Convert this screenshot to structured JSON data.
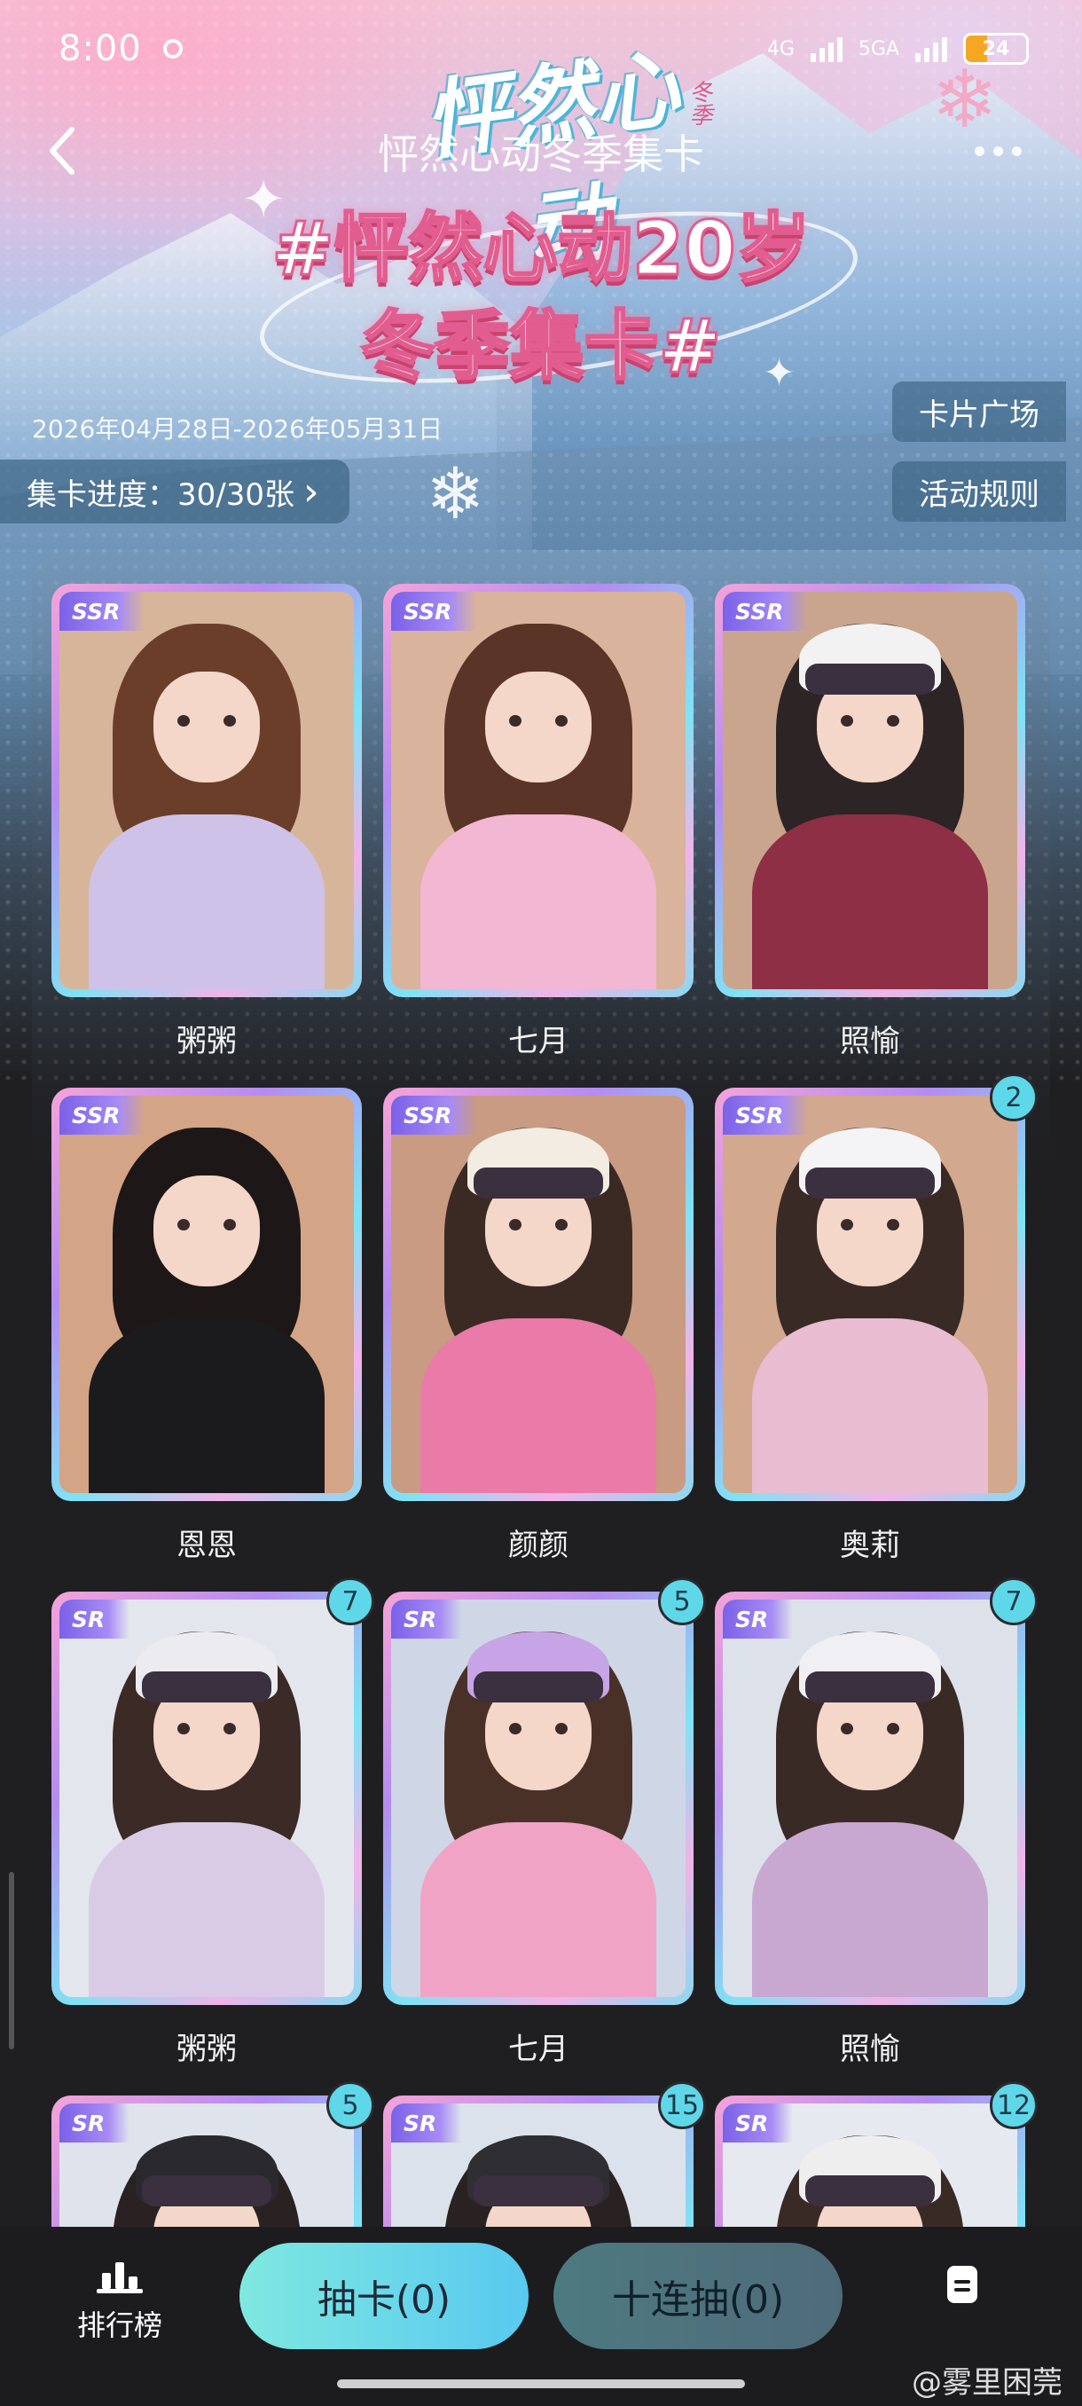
{
  "status_bar": {
    "time": "8:00",
    "net1": "4G",
    "net2": "5GA",
    "battery": "24"
  },
  "nav": {
    "title": "怦然心动冬季集卡"
  },
  "banner": {
    "logo_main": "怦然心动",
    "logo_sub": "冬季",
    "hashtag_line1": "#怦然心动20岁",
    "hashtag_line2": "冬季集卡#",
    "date_range": "2026年04月28日-2026年05月31日",
    "progress": "集卡进度：30/30张",
    "progress_arrow": "›",
    "card_square_label": "卡片广场",
    "rules_label": "活动规则"
  },
  "colors": {
    "accent_cyan": "#5ed8e8",
    "tier_purple": "#7b61e8",
    "panel_dark": "#1f1f21"
  },
  "cards": [
    {
      "name": "粥粥",
      "tier": "SSR",
      "count": null
    },
    {
      "name": "七月",
      "tier": "SSR",
      "count": null
    },
    {
      "name": "照愉",
      "tier": "SSR",
      "count": null
    },
    {
      "name": "恩恩",
      "tier": "SSR",
      "count": null
    },
    {
      "name": "颜颜",
      "tier": "SSR",
      "count": null
    },
    {
      "name": "奥莉",
      "tier": "SSR",
      "count": "2"
    },
    {
      "name": "粥粥",
      "tier": "SR",
      "count": "7"
    },
    {
      "name": "七月",
      "tier": "SR",
      "count": "5"
    },
    {
      "name": "照愉",
      "tier": "SR",
      "count": "7"
    },
    {
      "name": "",
      "tier": "SR",
      "count": "5"
    },
    {
      "name": "",
      "tier": "SR",
      "count": "15"
    },
    {
      "name": "",
      "tier": "SR",
      "count": "12"
    }
  ],
  "bottom": {
    "rank_label": "排行榜",
    "draw_single": "抽卡(0)",
    "draw_ten": "十连抽(0)"
  },
  "watermark": "@雾里困莞"
}
